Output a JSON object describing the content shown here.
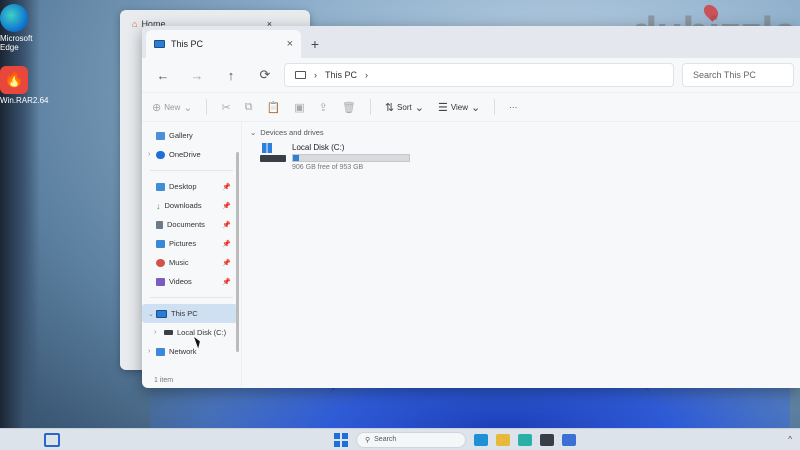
{
  "desktop": {
    "icons": [
      {
        "label": "Microsoft Edge",
        "icon": "edge-icon"
      },
      {
        "label": "Win.RAR2.64",
        "icon": "app-icon"
      }
    ],
    "watermark": "dubizzle"
  },
  "background_window": {
    "tab_title": "Home",
    "close": "×"
  },
  "explorer": {
    "tab": {
      "title": "This PC",
      "close": "×"
    },
    "new_tab": "+",
    "nav": {
      "back": "←",
      "forward": "→",
      "up": "↑",
      "refresh": "⟳"
    },
    "address": {
      "segments": [
        "This PC"
      ],
      "separator": "›"
    },
    "search": {
      "placeholder": "Search This PC"
    },
    "commands": {
      "new": "New",
      "sort": "Sort",
      "view": "View",
      "more": "···"
    },
    "sidebar": {
      "items": [
        {
          "label": "Gallery",
          "icon": "gallery-icon",
          "color": "#4a90d9"
        },
        {
          "label": "OneDrive",
          "icon": "onedrive-icon",
          "color": "#1e6fd9",
          "chevron": "›"
        },
        {
          "label": "Desktop",
          "icon": "desktop-icon",
          "color": "#3f8fd6",
          "pinned": true
        },
        {
          "label": "Downloads",
          "icon": "download-icon",
          "color": "#3a9a5a",
          "pinned": true
        },
        {
          "label": "Documents",
          "icon": "documents-icon",
          "color": "#6c7a8a",
          "pinned": true
        },
        {
          "label": "Pictures",
          "icon": "pictures-icon",
          "color": "#3b88d6",
          "pinned": true
        },
        {
          "label": "Music",
          "icon": "music-icon",
          "color": "#d2524a",
          "pinned": true
        },
        {
          "label": "Videos",
          "icon": "videos-icon",
          "color": "#7a5cc2",
          "pinned": true
        },
        {
          "label": "This PC",
          "icon": "this-pc-icon",
          "color": "#2b7cd3",
          "chevron": "⌄",
          "selected": true
        },
        {
          "label": "Local Disk (C:)",
          "icon": "drive-icon",
          "color": "#3a3f47",
          "chevron": "›"
        },
        {
          "label": "Network",
          "icon": "network-icon",
          "color": "#3b88d6",
          "chevron": "›"
        }
      ]
    },
    "group": {
      "title": "Devices and drives",
      "chevron": "⌄"
    },
    "drive": {
      "name": "Local Disk (C:)",
      "free_text": "906 GB free of 953 GB",
      "used_fraction": 0.05
    },
    "status": "1 item"
  },
  "taskbar": {
    "search_label": "Search",
    "apps": [
      {
        "icon": "edge-icon",
        "color": "#1f8fd6"
      },
      {
        "icon": "folder-icon",
        "color": "#e7b93a"
      },
      {
        "icon": "edge-icon",
        "color": "#2ab0a8"
      },
      {
        "icon": "store-icon",
        "color": "#3a3f47"
      },
      {
        "icon": "app-icon",
        "color": "#3b6fd6"
      }
    ],
    "tray": "^"
  }
}
